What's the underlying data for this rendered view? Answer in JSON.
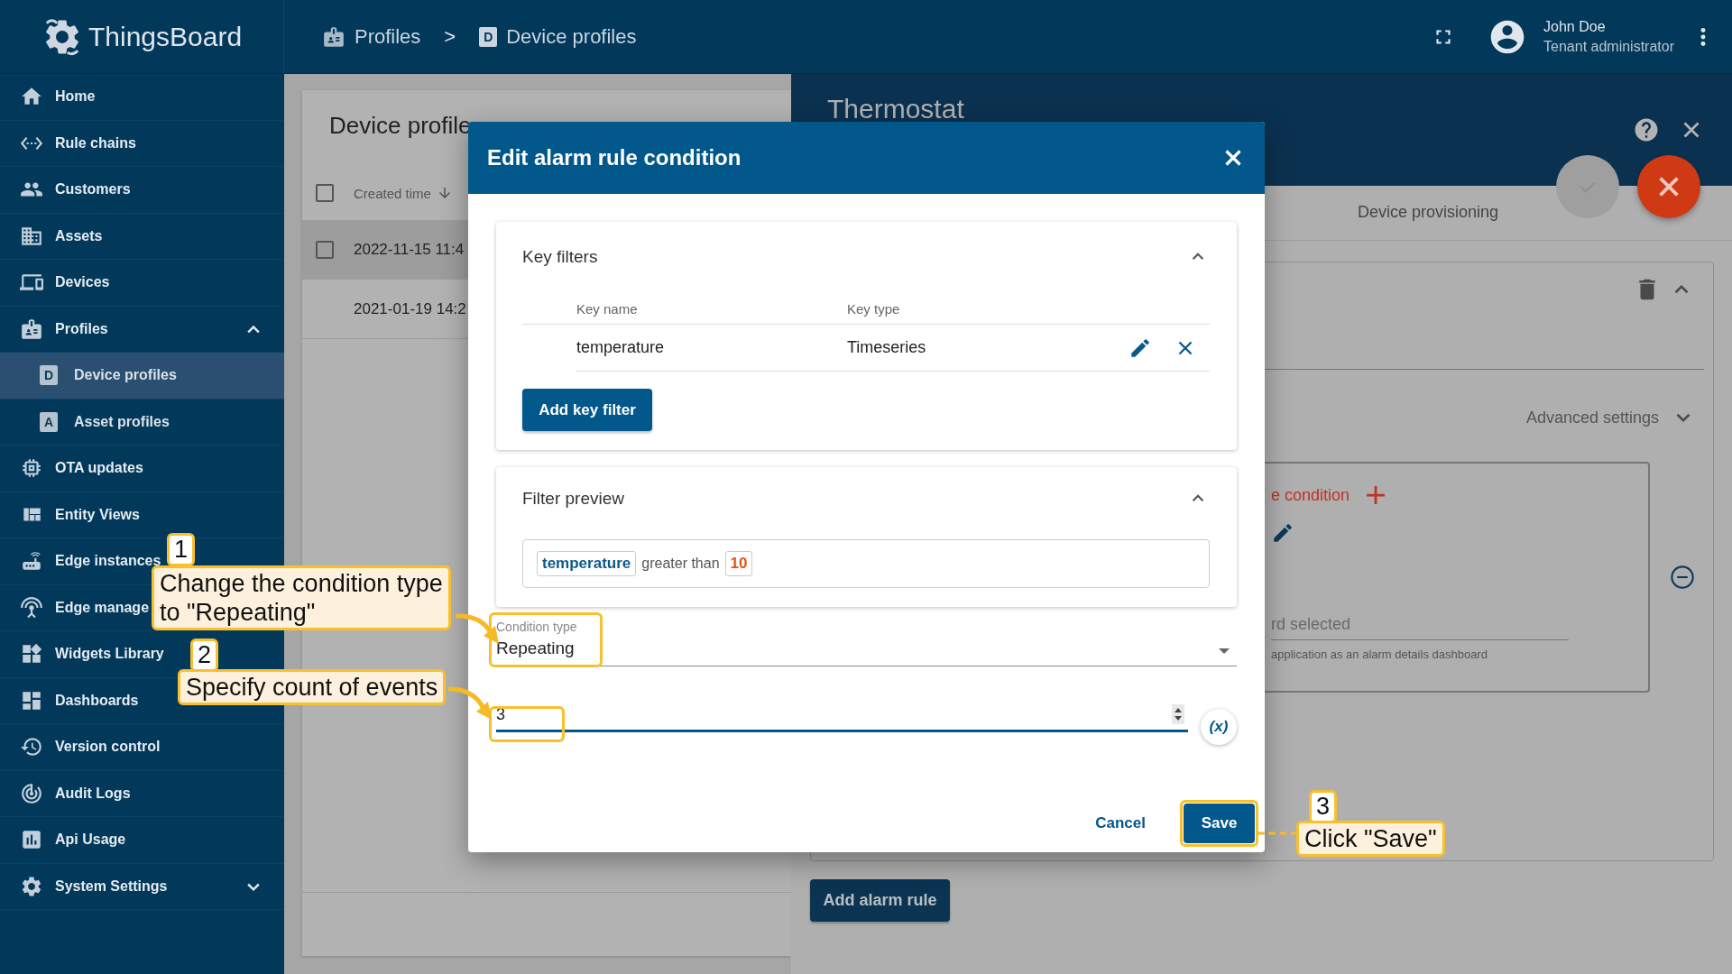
{
  "app": {
    "name": "ThingsBoard"
  },
  "breadcrumbs": {
    "separator": ">",
    "items": [
      {
        "label": "Profiles"
      },
      {
        "label": "Device profiles",
        "badge": "D"
      }
    ]
  },
  "user": {
    "name": "John Doe",
    "role": "Tenant administrator"
  },
  "sidebar": {
    "items": [
      {
        "label": "Home",
        "selected": false
      },
      {
        "label": "Rule chains",
        "selected": false
      },
      {
        "label": "Customers",
        "selected": false
      },
      {
        "label": "Assets",
        "selected": false
      },
      {
        "label": "Devices",
        "selected": false
      },
      {
        "label": "Profiles",
        "selected": false,
        "expanded": true,
        "children": [
          {
            "label": "Device profiles",
            "badge": "D",
            "selected": true
          },
          {
            "label": "Asset profiles",
            "badge": "A",
            "selected": false
          }
        ]
      },
      {
        "label": "OTA updates",
        "selected": false
      },
      {
        "label": "Entity Views",
        "selected": false
      },
      {
        "label": "Edge instances",
        "selected": false
      },
      {
        "label": "Edge manage",
        "selected": false
      },
      {
        "label": "Widgets Library",
        "selected": false
      },
      {
        "label": "Dashboards",
        "selected": false
      },
      {
        "label": "Version control",
        "selected": false
      },
      {
        "label": "Audit Logs",
        "selected": false
      },
      {
        "label": "Api Usage",
        "selected": false
      },
      {
        "label": "System Settings",
        "selected": false,
        "expanded": false
      }
    ]
  },
  "profiles_list": {
    "title": "Device profile",
    "select_all": {
      "checked": false
    },
    "columns": [
      {
        "label": "Created time",
        "sort_descending": true
      }
    ],
    "rows": [
      {
        "created_time": "2022-11-15 11:4",
        "highlighted": true,
        "checked": false
      },
      {
        "created_time": "2021-01-19 14:2",
        "highlighted": false
      }
    ]
  },
  "details": {
    "title": "Thermostat",
    "tabs": [
      {
        "label": "Device provisioning",
        "selected": false
      }
    ],
    "advanced_settings": {
      "label": "Advanced settings",
      "expanded": false
    },
    "condition_link": "e condition",
    "dashboard_field": {
      "placeholder": "rd selected",
      "hint": "application as an alarm details dashboard"
    },
    "add_alarm_rule": "Add alarm rule"
  },
  "dialog": {
    "title": "Edit alarm rule condition",
    "key_filters": {
      "title": "Key filters",
      "expanded": true,
      "columns": [
        "Key name",
        "Key type"
      ],
      "rows": [
        {
          "key_name": "temperature",
          "key_type": "Timeseries"
        }
      ],
      "add_button": "Add key filter"
    },
    "filter_preview": {
      "title": "Filter preview",
      "expanded": true,
      "tokens": [
        {
          "kind": "key",
          "text": "temperature"
        },
        {
          "kind": "operator",
          "text": "greater than"
        },
        {
          "kind": "value",
          "text": "10"
        }
      ]
    },
    "condition_type": {
      "label": "Condition type",
      "value": "Repeating"
    },
    "count": {
      "value": "3",
      "focused": true
    },
    "variable_button": "(x)",
    "buttons": [
      {
        "label": "Cancel",
        "kind": "text"
      },
      {
        "label": "Save",
        "kind": "primary"
      }
    ]
  },
  "annotations": [
    {
      "number": "1",
      "text": "Change the condition type\nto \"Repeating\""
    },
    {
      "number": "2",
      "text": "Specify count of events"
    },
    {
      "number": "3",
      "text": "Click \"Save\""
    }
  ]
}
